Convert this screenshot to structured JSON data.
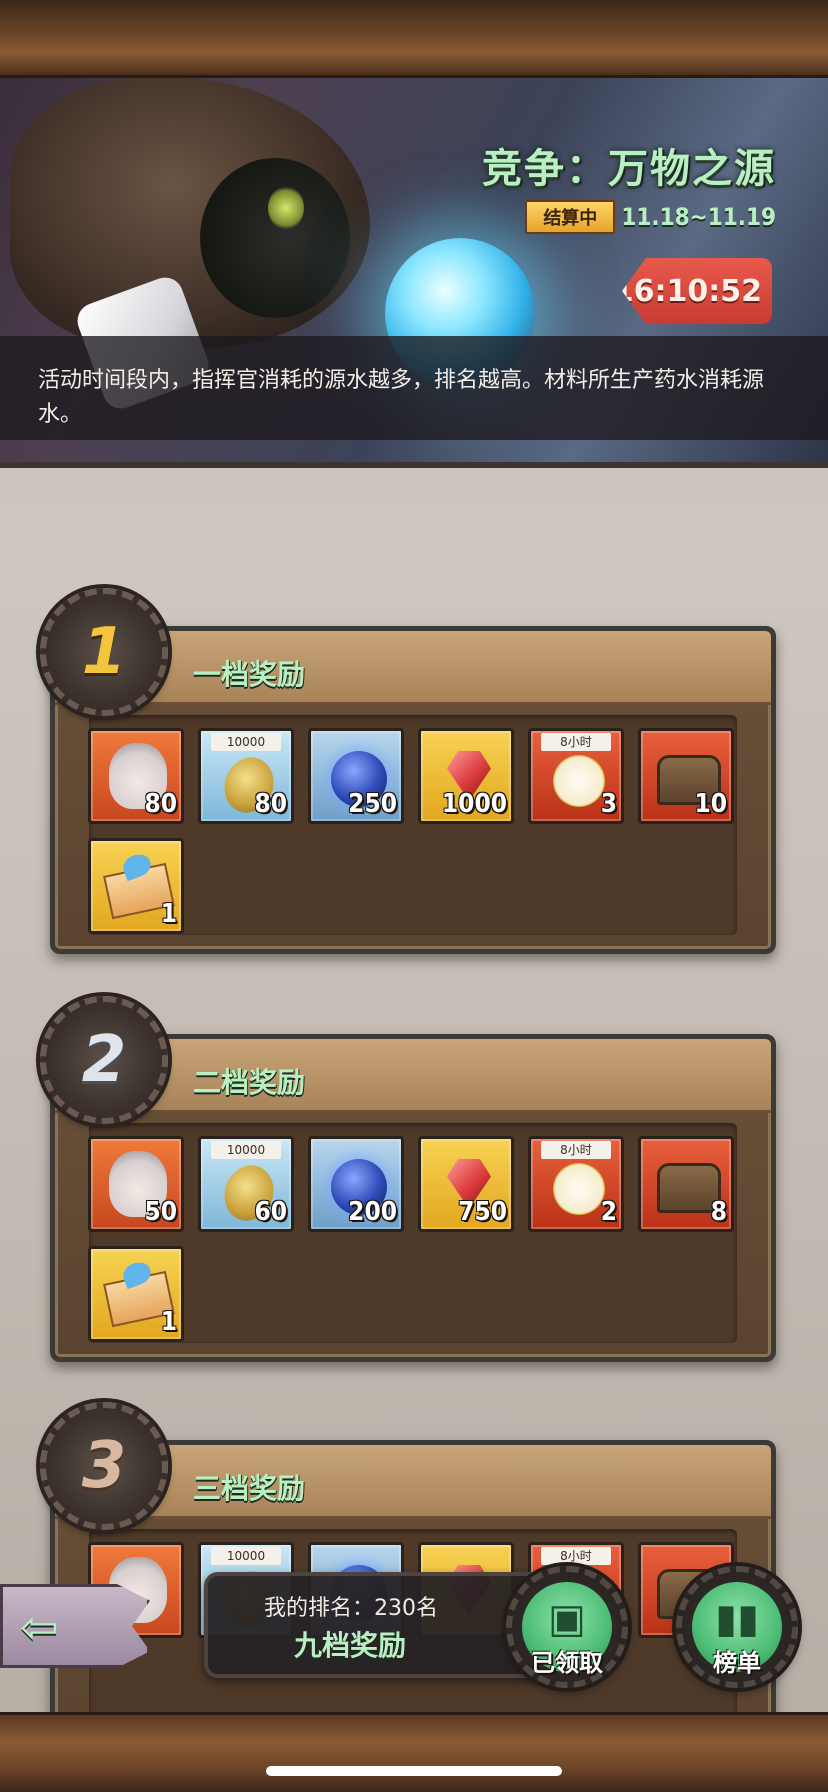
{
  "banner": {
    "title": "竞争：万物之源",
    "status": "结算中",
    "dates": "11.18~11.19",
    "timer": "16:10:52",
    "description": "活动时间段内，指挥官消耗的源水越多，排名越高。材料所生产药水消耗源水。"
  },
  "tiers": [
    {
      "rank": "1",
      "title": "一档奖励",
      "items": [
        {
          "icon": "hero-portrait-icon",
          "qty": "80"
        },
        {
          "icon": "gold-coin-icon",
          "top": "10000",
          "qty": "80"
        },
        {
          "icon": "blue-orb-icon",
          "qty": "250"
        },
        {
          "icon": "red-gem-icon",
          "qty": "1000"
        },
        {
          "icon": "clock-icon",
          "top": "8小时",
          "qty": "3"
        },
        {
          "icon": "chest-icon",
          "qty": "10"
        },
        {
          "icon": "envelope-icon",
          "qty": "1"
        }
      ]
    },
    {
      "rank": "2",
      "title": "二档奖励",
      "items": [
        {
          "icon": "hero-portrait-icon",
          "qty": "50"
        },
        {
          "icon": "gold-coin-icon",
          "top": "10000",
          "qty": "60"
        },
        {
          "icon": "blue-orb-icon",
          "qty": "200"
        },
        {
          "icon": "red-gem-icon",
          "qty": "750"
        },
        {
          "icon": "clock-icon",
          "top": "8小时",
          "qty": "2"
        },
        {
          "icon": "chest-icon",
          "qty": "8"
        },
        {
          "icon": "envelope-icon",
          "qty": "1"
        }
      ]
    },
    {
      "rank": "3",
      "title": "三档奖励",
      "items": [
        {
          "icon": "hero-portrait-icon",
          "qty": ""
        },
        {
          "icon": "gold-coin-icon",
          "top": "10000",
          "qty": ""
        },
        {
          "icon": "blue-orb-icon",
          "qty": ""
        },
        {
          "icon": "red-gem-icon",
          "qty": ""
        },
        {
          "icon": "clock-icon",
          "top": "8小时",
          "qty": ""
        },
        {
          "icon": "chest-icon",
          "qty": ""
        }
      ]
    }
  ],
  "footer": {
    "my_rank": "我的排名：230名",
    "my_tier": "九档奖励",
    "claimed_label": "已领取",
    "leaderboard_label": "榜单"
  }
}
